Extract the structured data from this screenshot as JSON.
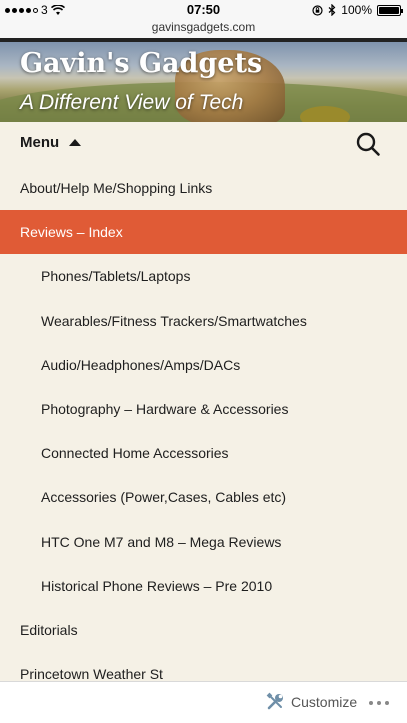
{
  "status_bar": {
    "carrier": "3",
    "time": "07:50",
    "battery_percent": "100%",
    "signal_bars": 4
  },
  "browser": {
    "url": "gavinsgadgets.com"
  },
  "header": {
    "site_title": "Gavin's Gadgets",
    "tagline": "A Different View of Tech"
  },
  "menu": {
    "toggle_label": "Menu",
    "items": [
      {
        "label": "About/Help Me/Shopping Links",
        "level": "top"
      },
      {
        "label": "Reviews – Index",
        "level": "top",
        "active": true
      },
      {
        "label": "Phones/Tablets/Laptops",
        "level": "sub"
      },
      {
        "label": "Wearables/Fitness Trackers/Smartwatches",
        "level": "sub"
      },
      {
        "label": "Audio/Headphones/Amps/DACs",
        "level": "sub"
      },
      {
        "label": "Photography – Hardware & Accessories",
        "level": "sub"
      },
      {
        "label": "Connected Home Accessories",
        "level": "sub"
      },
      {
        "label": "Accessories (Power,Cases, Cables etc)",
        "level": "sub"
      },
      {
        "label": "HTC One M7 and M8 – Mega Reviews",
        "level": "sub"
      },
      {
        "label": "Historical Phone Reviews – Pre 2010",
        "level": "sub"
      },
      {
        "label": "Editorials",
        "level": "top"
      },
      {
        "label": "Princetown Weather St",
        "level": "top"
      }
    ]
  },
  "customize_bar": {
    "customize_label": "Customize"
  },
  "colors": {
    "accent": "#e05b36",
    "page_background": "#f5f1e6"
  },
  "icons": {
    "search": "search-icon",
    "customize": "wrench-screwdriver-icon",
    "more": "more-dots-icon",
    "menu_caret": "caret-up-icon"
  }
}
